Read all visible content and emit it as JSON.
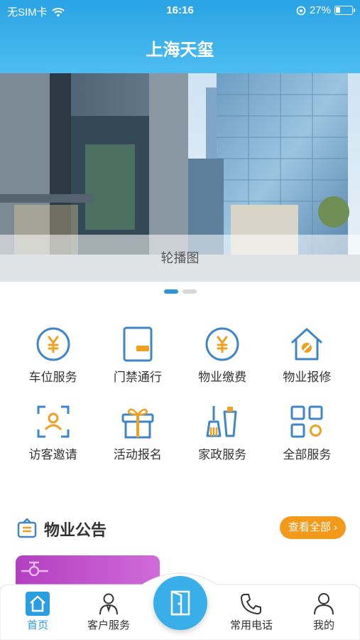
{
  "status_bar": {
    "carrier": "无SIM卡",
    "time": "16:16",
    "battery": "27%",
    "battery_level": 0.27
  },
  "header": {
    "title": "上海天玺"
  },
  "banner": {
    "caption": "轮播图",
    "page_count": 2,
    "active_page": 1
  },
  "services": [
    {
      "label": "车位服务",
      "icon": "yen-circle-icon"
    },
    {
      "label": "门禁通行",
      "icon": "door-card-icon"
    },
    {
      "label": "物业缴费",
      "icon": "yen-circle-icon"
    },
    {
      "label": "物业报修",
      "icon": "house-wrench-icon"
    },
    {
      "label": "访客邀请",
      "icon": "visitor-scan-icon"
    },
    {
      "label": "活动报名",
      "icon": "gift-icon"
    },
    {
      "label": "家政服务",
      "icon": "cleaning-icon"
    },
    {
      "label": "全部服务",
      "icon": "grid-icon"
    }
  ],
  "notice": {
    "title": "物业公告",
    "view_all": "查看全部"
  },
  "tabbar": {
    "home": "首页",
    "customer_service": "客户服务",
    "phone": "常用电话",
    "mine": "我的"
  },
  "colors": {
    "header_top": "#2aa3e4",
    "icon_blue": "#3f86c9",
    "icon_orange": "#f0a020",
    "view_all_bg": "#f39a1a",
    "tab_active": "#2a9ee3"
  }
}
